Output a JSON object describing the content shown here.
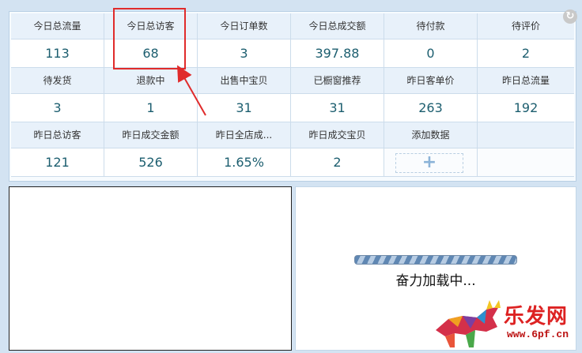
{
  "stats": {
    "row1": [
      {
        "label": "今日总流量",
        "value": "113"
      },
      {
        "label": "今日总访客",
        "value": "68"
      },
      {
        "label": "今日订单数",
        "value": "3"
      },
      {
        "label": "今日总成交额",
        "value": "397.88"
      },
      {
        "label": "待付款",
        "value": "0"
      },
      {
        "label": "待评价",
        "value": "2"
      }
    ],
    "row2": [
      {
        "label": "待发货",
        "value": "3"
      },
      {
        "label": "退款中",
        "value": "1"
      },
      {
        "label": "出售中宝贝",
        "value": "31"
      },
      {
        "label": "已橱窗推荐",
        "value": "31"
      },
      {
        "label": "昨日客单价",
        "value": "263"
      },
      {
        "label": "昨日总流量",
        "value": "192"
      }
    ],
    "row3": [
      {
        "label": "昨日总访客",
        "value": "121"
      },
      {
        "label": "昨日成交金额",
        "value": "526"
      },
      {
        "label": "昨日全店成...",
        "value": "1.65%"
      },
      {
        "label": "昨日成交宝贝",
        "value": "2"
      },
      {
        "label": "添加数据",
        "value": "+"
      }
    ]
  },
  "loading": {
    "text": "奋力加载中...",
    "progress_percent": 100
  },
  "watermark": {
    "title": "乐发网",
    "url": "www.6pf.cn"
  },
  "colors": {
    "highlight": "#e02b2b",
    "value_text": "#1c5e6f",
    "label_bg": "#e8f1fa"
  },
  "icons": {
    "refresh": "refresh-icon"
  }
}
